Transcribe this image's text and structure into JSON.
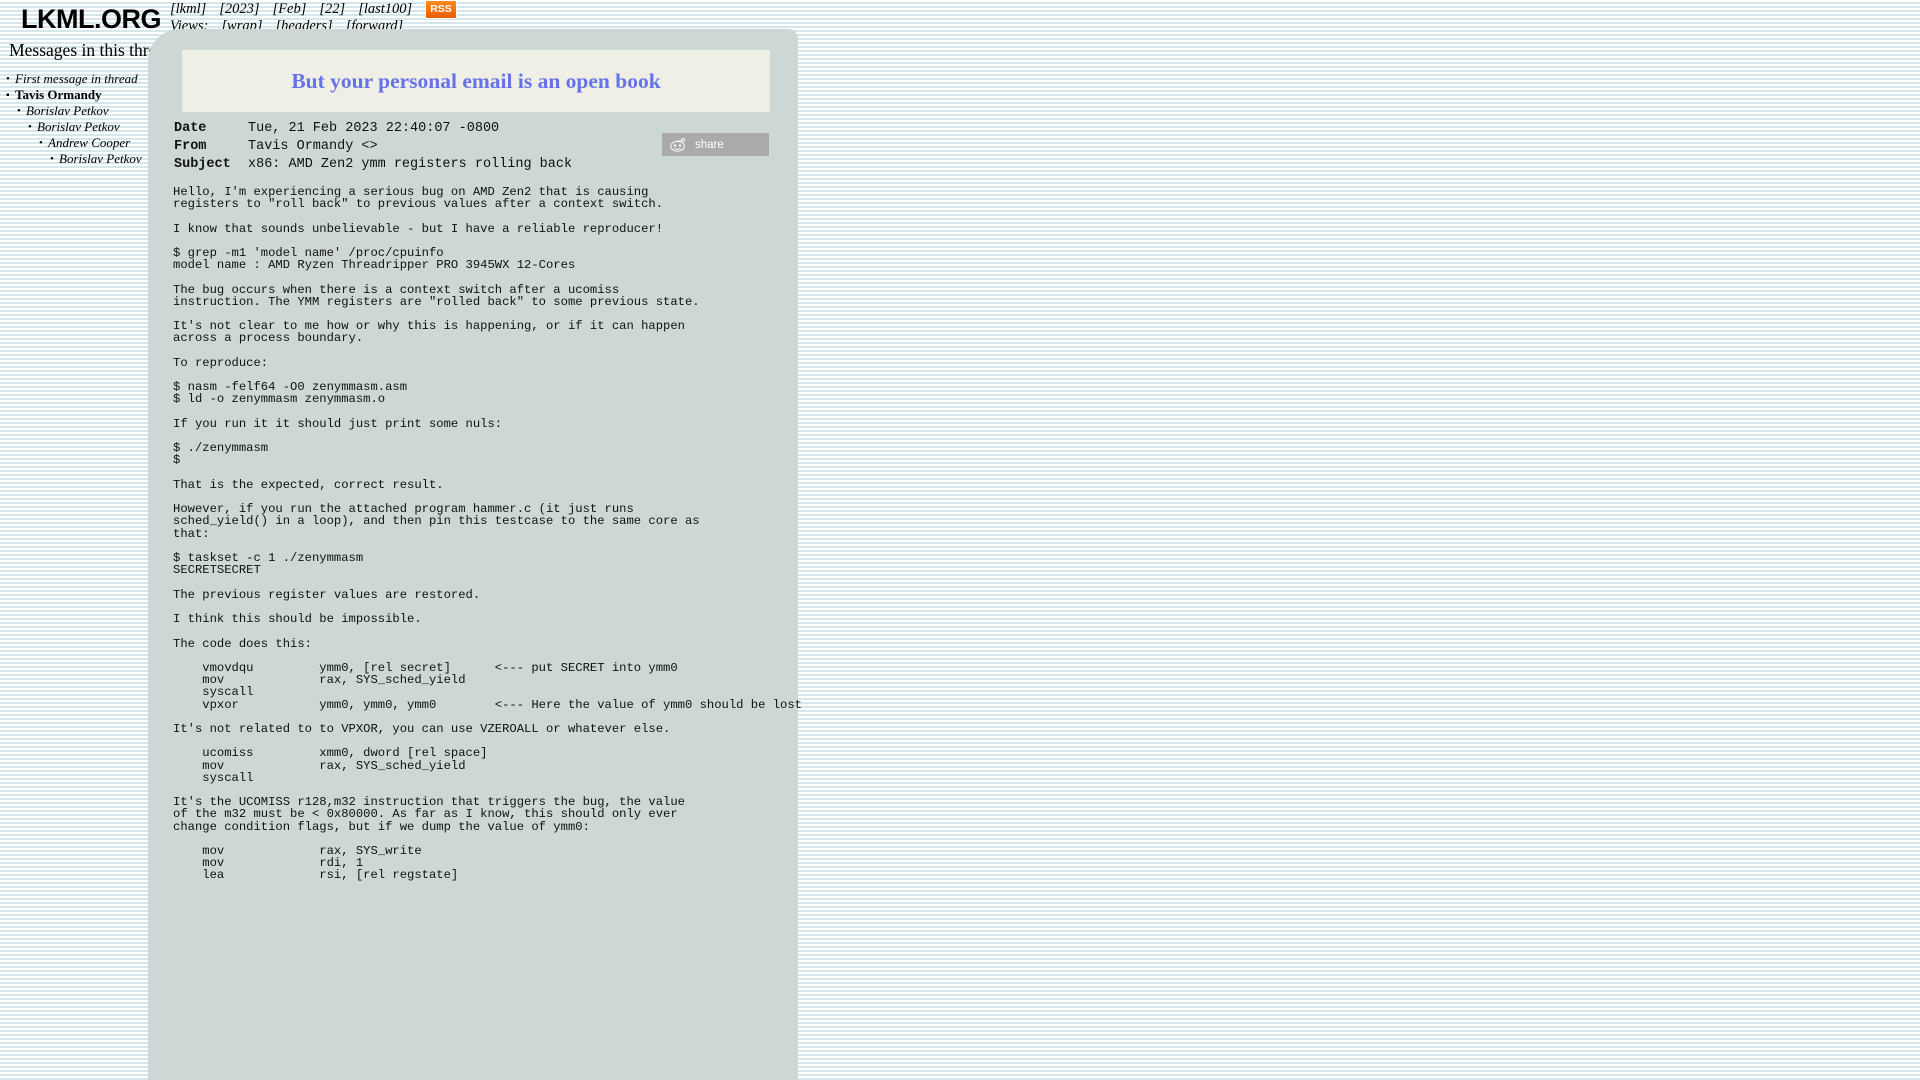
{
  "site": {
    "logo": "LKML.ORG",
    "thread_heading": "Messages in this thread"
  },
  "topnav": {
    "breadcrumbs": [
      {
        "label": "[lkml]",
        "name": "nav-lkml"
      },
      {
        "label": "[2023]",
        "name": "nav-year"
      },
      {
        "label": "[Feb]",
        "name": "nav-month"
      },
      {
        "label": "[22]",
        "name": "nav-day"
      },
      {
        "label": "[last100]",
        "name": "nav-last100"
      }
    ],
    "rss_label": "RSS",
    "views_label": "Views:",
    "views": [
      {
        "label": "[wrap]",
        "name": "view-wrap"
      },
      {
        "label": "[headers]",
        "name": "view-headers"
      },
      {
        "label": "[forward]",
        "name": "view-forward"
      }
    ]
  },
  "thread": {
    "items": [
      {
        "label": "First message in thread",
        "indent": 0,
        "current": false
      },
      {
        "label": "Tavis Ormandy",
        "indent": 0,
        "current": true
      },
      {
        "label": "Borislav Petkov",
        "indent": 1,
        "current": false
      },
      {
        "label": "Borislav Petkov",
        "indent": 2,
        "current": false
      },
      {
        "label": "Andrew Cooper",
        "indent": 3,
        "current": false
      },
      {
        "label": "Borislav Petkov",
        "indent": 4,
        "current": false
      }
    ]
  },
  "message": {
    "banner_subject": "But your personal email is an open book",
    "headers": [
      {
        "key": "Date",
        "value": "Tue, 21 Feb 2023 22:40:07 -0800"
      },
      {
        "key": "From",
        "value": "Tavis Ormandy <>"
      },
      {
        "key": "Subject",
        "value": "x86: AMD Zen2 ymm registers rolling back"
      }
    ],
    "share_label": "share",
    "body": "Hello, I'm experiencing a serious bug on AMD Zen2 that is causing\nregisters to \"roll back\" to previous values after a context switch.\n\nI know that sounds unbelievable - but I have a reliable reproducer!\n\n$ grep -m1 'model name' /proc/cpuinfo\nmodel name : AMD Ryzen Threadripper PRO 3945WX 12-Cores\n\nThe bug occurs when there is a context switch after a ucomiss\ninstruction. The YMM registers are \"rolled back\" to some previous state.\n\nIt's not clear to me how or why this is happening, or if it can happen\nacross a process boundary.\n\nTo reproduce:\n\n$ nasm -felf64 -O0 zenymmasm.asm\n$ ld -o zenymmasm zenymmasm.o\n\nIf you run it it should just print some nuls:\n\n$ ./zenymmasm\n$\n\nThat is the expected, correct result.\n\nHowever, if you run the attached program hammer.c (it just runs\nsched_yield() in a loop), and then pin this testcase to the same core as\nthat:\n\n$ taskset -c 1 ./zenymmasm\nSECRETSECRET\n\nThe previous register values are restored.\n\nI think this should be impossible.\n\nThe code does this:\n\n    vmovdqu         ymm0, [rel secret]      <--- put SECRET into ymm0\n    mov             rax, SYS_sched_yield\n    syscall\n    vpxor           ymm0, ymm0, ymm0        <--- Here the value of ymm0 should be lost\n\nIt's not related to to VPXOR, you can use VZEROALL or whatever else.\n\n    ucomiss         xmm0, dword [rel space]\n    mov             rax, SYS_sched_yield\n    syscall\n\nIt's the UCOMISS r128,m32 instruction that triggers the bug, the value\nof the m32 must be < 0x80000. As far as I know, this should only ever\nchange condition flags, but if we dump the value of ymm0:\n\n    mov             rax, SYS_write\n    mov             rdi, 1\n    lea             rsi, [rel regstate]"
  },
  "colors": {
    "panel": "#ccd7d6",
    "banner": "#efefe6",
    "subject_text": "#6672e8",
    "rss": "#f06a00",
    "share_bg": "#aaaaaa",
    "stripe": "#d5e7ea"
  }
}
